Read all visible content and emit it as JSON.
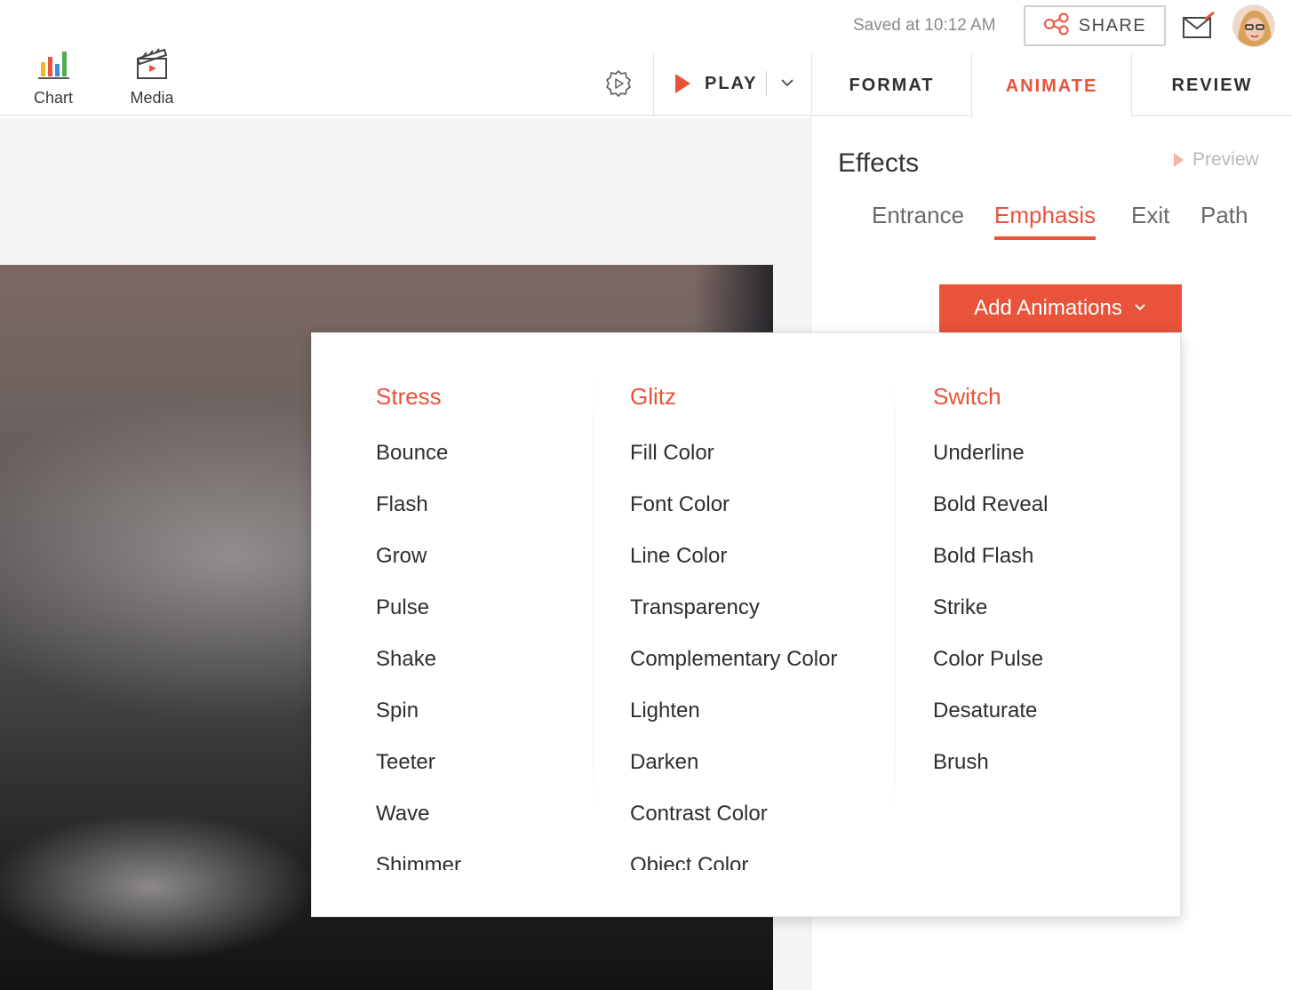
{
  "toolbar": {
    "insert_items": [
      {
        "label": "Chart",
        "icon": "bar-chart-icon"
      },
      {
        "label": "Media",
        "icon": "clapperboard-icon"
      }
    ],
    "saved_status": "Saved at 10:12 AM",
    "share_label": "SHARE",
    "play_label": "PLAY",
    "tabs": [
      {
        "label": "FORMAT",
        "active": false
      },
      {
        "label": "ANIMATE",
        "active": true
      },
      {
        "label": "REVIEW",
        "active": false
      }
    ]
  },
  "panel": {
    "title": "Effects",
    "preview_label": "Preview",
    "effect_tabs": [
      {
        "label": "Entrance",
        "active": false
      },
      {
        "label": "Emphasis",
        "active": true
      },
      {
        "label": "Exit",
        "active": false
      },
      {
        "label": "Path",
        "active": false
      }
    ],
    "add_animations_label": "Add Animations"
  },
  "animation_menu": {
    "columns": [
      {
        "heading": "Stress",
        "items": [
          "Bounce",
          "Flash",
          "Grow",
          "Pulse",
          "Shake",
          "Spin",
          "Teeter",
          "Wave",
          "Shimmer"
        ]
      },
      {
        "heading": "Glitz",
        "items": [
          "Fill Color",
          "Font Color",
          "Line Color",
          "Transparency",
          "Complementary Color",
          "Lighten",
          "Darken",
          "Contrast Color",
          "Object Color"
        ]
      },
      {
        "heading": "Switch",
        "items": [
          "Underline",
          "Bold Reveal",
          "Bold Flash",
          "Strike",
          "Color Pulse",
          "Desaturate",
          "Brush"
        ]
      }
    ]
  },
  "colors": {
    "accent": "#e8533a",
    "text": "#2e2e2e",
    "muted": "#8a8a8a"
  }
}
